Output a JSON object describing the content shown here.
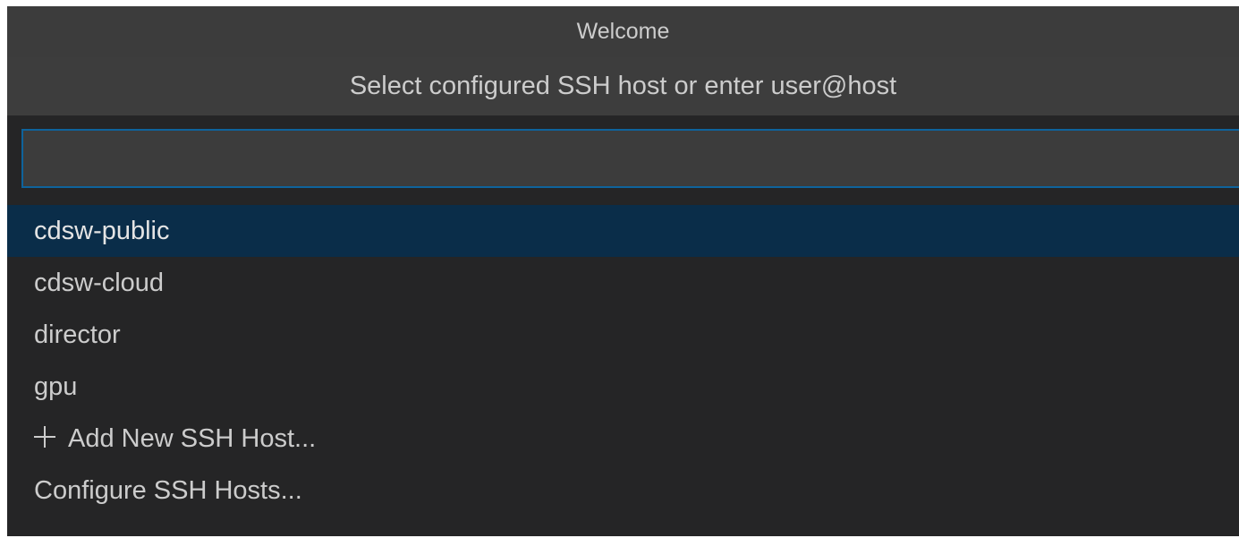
{
  "window": {
    "title": "Welcome"
  },
  "quick_pick": {
    "title": "Select configured SSH host or enter user@host",
    "input": {
      "value": "",
      "placeholder": ""
    },
    "items": [
      {
        "label": "cdsw-public",
        "selected": true
      },
      {
        "label": "cdsw-cloud"
      },
      {
        "label": "director"
      },
      {
        "label": "gpu"
      },
      {
        "label": "Add New SSH Host...",
        "icon": "plus-icon"
      },
      {
        "label": "Configure SSH Hosts..."
      }
    ]
  },
  "colors": {
    "background": "#252526",
    "titlebar": "#3c3c3c",
    "input_border": "#0e639c",
    "selected_row": "#0a2d49",
    "text": "#cccccc"
  }
}
